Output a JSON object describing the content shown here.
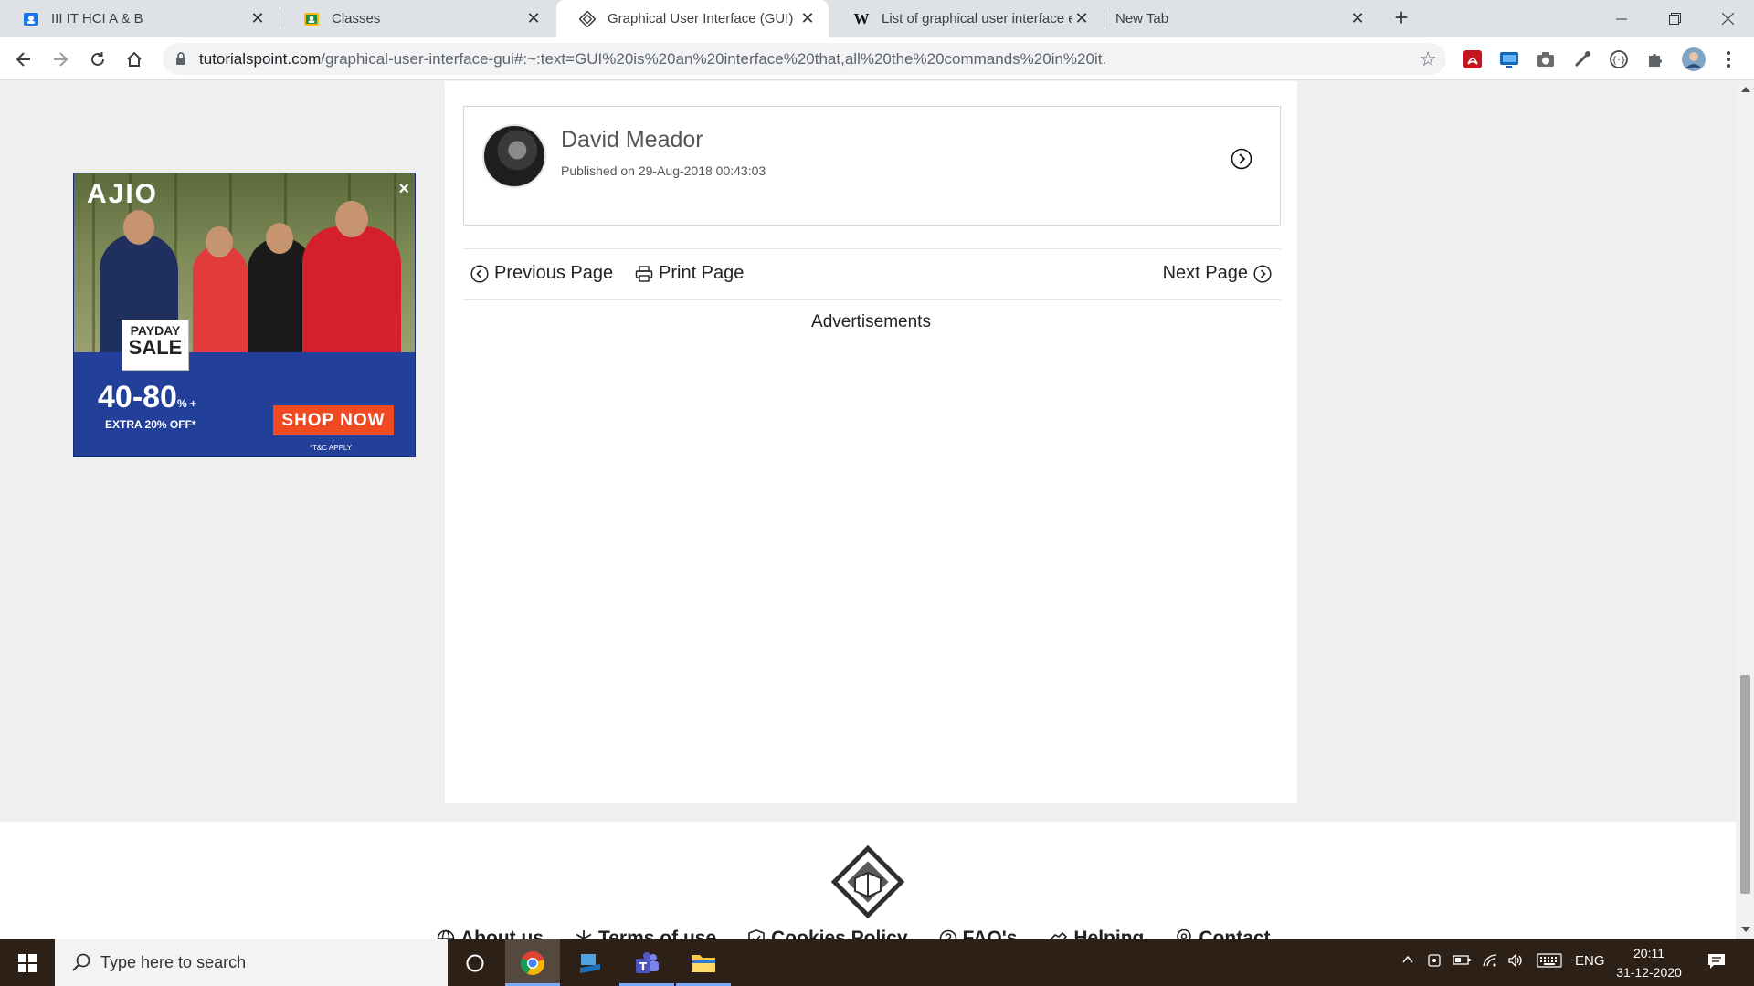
{
  "browser": {
    "tabs": [
      {
        "title": "III IT HCI A & B",
        "favicon": "classroom-icon"
      },
      {
        "title": "Classes",
        "favicon": "classroom-icon"
      },
      {
        "title": "Graphical User Interface (GUI)",
        "favicon": "tutorialspoint-icon",
        "active": true
      },
      {
        "title": "List of graphical user interface ele",
        "favicon": "wikipedia-icon"
      },
      {
        "title": "New Tab",
        "favicon": ""
      }
    ],
    "url_host": "tutorialspoint.com",
    "url_path": "/graphical-user-interface-gui#:~:text=GUI%20is%20an%20interface%20that,all%20the%20commands%20in%20it."
  },
  "article": {
    "author_name": "David Meador",
    "published": "Published on 29-Aug-2018 00:43:03",
    "prev_label": "Previous Page",
    "print_label": "Print Page",
    "next_label": "Next Page",
    "ads_label": "Advertisements"
  },
  "ad": {
    "brand": "AJIO",
    "close": "×",
    "payday_line1": "PAYDAY",
    "payday_line2": "SALE",
    "discount": "40-80",
    "discount_suffix": "% +",
    "extra": "EXTRA 20% OFF*",
    "cta": "SHOP NOW",
    "tnc": "*T&C APPLY"
  },
  "footer": {
    "links": [
      "About us",
      "Terms of use",
      "Cookies Policy",
      "FAQ's",
      "Helping",
      "Contact"
    ]
  },
  "taskbar": {
    "search_placeholder": "Type here to search",
    "language": "ENG",
    "time": "20:11",
    "date": "31-12-2020"
  },
  "colors": {
    "ad_blue": "#223f9a",
    "ad_cta": "#f04a23",
    "taskbar": "#2c2017"
  }
}
